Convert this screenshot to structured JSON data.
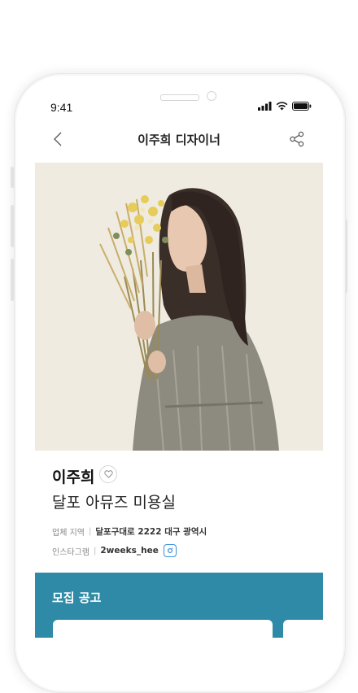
{
  "status_bar": {
    "time": "9:41"
  },
  "nav": {
    "title": "이주희 디자이너",
    "back_icon": "chevron-left-icon",
    "share_icon": "share-icon"
  },
  "profile": {
    "name": "이주희",
    "shop": "달포 아뮤즈 미용실",
    "location_label": "업체 지역",
    "location_value": "달포구대로 2222 대구 광역시",
    "instagram_label": "인스타그램",
    "instagram_value": "2weeks_hee"
  },
  "recruit": {
    "title": "모집 공고"
  },
  "colors": {
    "accent": "#2e8aa6",
    "instagram": "#3a8fdc",
    "hero_bg": "#efebe1"
  }
}
